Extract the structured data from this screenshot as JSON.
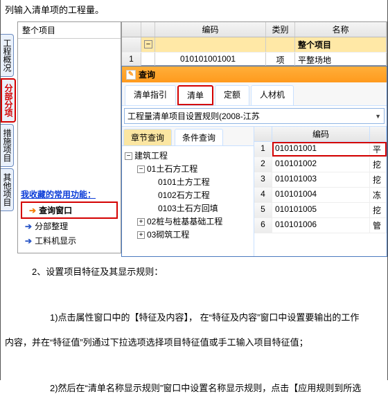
{
  "top_text": "列输入清单项的工程量。",
  "vtabs": [
    {
      "label": "工程概况"
    },
    {
      "label": "分部分项",
      "active": true
    },
    {
      "label": "措施项目"
    },
    {
      "label": "其他项目"
    }
  ],
  "left_title": "整个项目",
  "fav_header": "我收藏的常用功能：",
  "fav_items": [
    {
      "label": "查询窗口",
      "hl": true,
      "arrow": "orange"
    },
    {
      "label": "分部整理",
      "arrow": "blue"
    },
    {
      "label": "工料机显示",
      "arrow": "blue"
    }
  ],
  "upper_header": {
    "code": "编码",
    "type": "类别",
    "name": "名称"
  },
  "upper_rows": [
    {
      "sn": "",
      "exp": "−",
      "code": "",
      "type": "",
      "name": "整个项目",
      "sel": true,
      "bold": true
    },
    {
      "sn": "1",
      "exp": "",
      "code": "010101001001",
      "type": "项",
      "name": "平整场地"
    }
  ],
  "query_title": "查询",
  "main_tabs": [
    {
      "label": "清单指引"
    },
    {
      "label": "清单",
      "active": true
    },
    {
      "label": "定额"
    },
    {
      "label": "人材机"
    }
  ],
  "rule_text": "工程量清单项目设置规则(2008-江苏",
  "sub_tabs": [
    {
      "label": "章节查询",
      "active": true
    },
    {
      "label": "条件查询"
    }
  ],
  "tree": [
    {
      "lvl": 0,
      "tg": "−",
      "label": "建筑工程"
    },
    {
      "lvl": 1,
      "tg": "−",
      "label": "01土石方工程"
    },
    {
      "lvl": 2,
      "tg": "",
      "label": "0101土方工程"
    },
    {
      "lvl": 2,
      "tg": "",
      "label": "0102石方工程"
    },
    {
      "lvl": 2,
      "tg": "",
      "label": "0103土石方回填"
    },
    {
      "lvl": 1,
      "tg": "+",
      "label": "02桩与桩基基础工程"
    },
    {
      "lvl": 1,
      "tg": "+",
      "label": "03砌筑工程"
    }
  ],
  "grid_header": {
    "code": "编码"
  },
  "grid_rows": [
    {
      "sn": "1",
      "code": "010101001",
      "ex": "平",
      "hl": true
    },
    {
      "sn": "2",
      "code": "010101002",
      "ex": "挖"
    },
    {
      "sn": "3",
      "code": "010101003",
      "ex": "挖"
    },
    {
      "sn": "4",
      "code": "010101004",
      "ex": "冻"
    },
    {
      "sn": "5",
      "code": "010101005",
      "ex": "挖"
    },
    {
      "sn": "6",
      "code": "010101006",
      "ex": "管"
    }
  ],
  "body_paragraphs": [
    "2、设置项目特征及其显示规则：",
    "1)点击属性窗口中的【特征及内容】，  在“特征及内容”窗口中设置要输出的工作",
    "内容，并在“特征值”列通过下拉选项选择项目特征值或手工输入项目特征值；",
    "2)然后在“清单名称显示规则”窗口中设置名称显示规则，点击【应用规则到所选"
  ]
}
